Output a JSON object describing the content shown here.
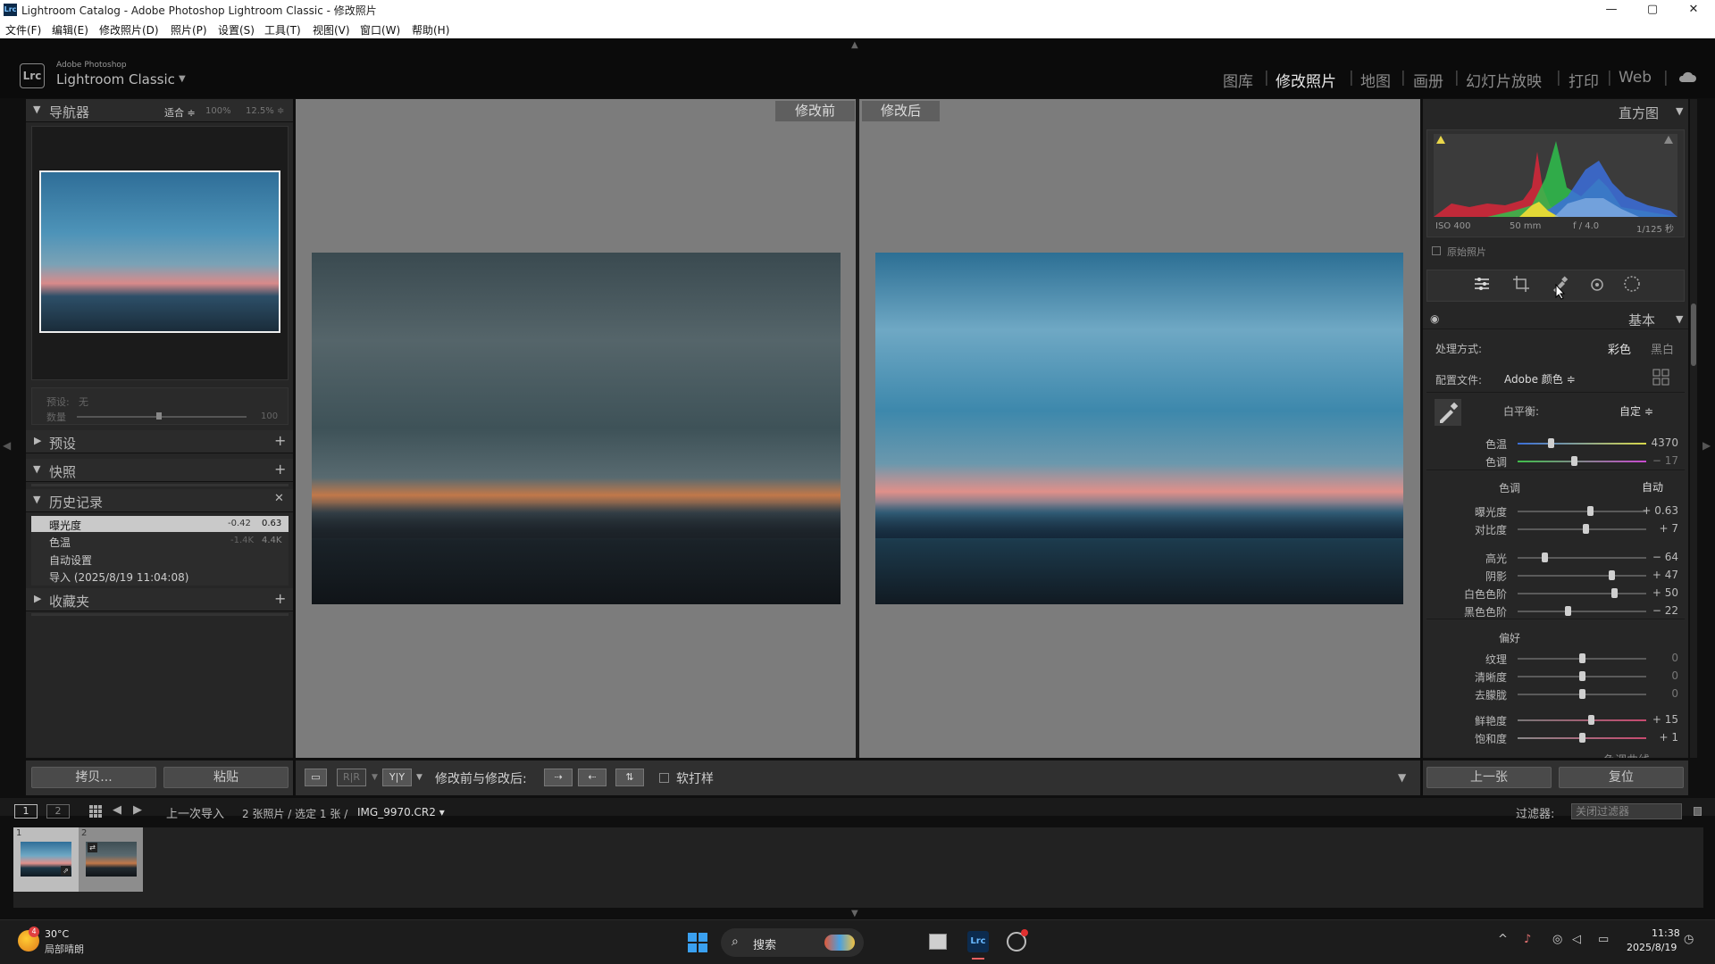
{
  "window": {
    "title": "Lightroom Catalog - Adobe Photoshop Lightroom Classic - 修改照片",
    "app_icon": "Lrc"
  },
  "menu": [
    "文件(F)",
    "编辑(E)",
    "修改照片(D)",
    "照片(P)",
    "设置(S)",
    "工具(T)",
    "视图(V)",
    "窗口(W)",
    "帮助(H)"
  ],
  "brand": {
    "top": "Adobe Photoshop",
    "name": "Lightroom Classic",
    "logo": "Lrc"
  },
  "modules": [
    "图库",
    "修改照片",
    "地图",
    "画册",
    "幻灯片放映",
    "打印",
    "Web"
  ],
  "active_module": "修改照片",
  "navigator": {
    "title": "导航器",
    "fit": "适合 ≑",
    "p100": "100%",
    "p125": "12.5% ≑"
  },
  "preset_box": {
    "preset_label": "预设:",
    "preset_value": "无",
    "amount_label": "数量",
    "amount_value": "100"
  },
  "left_sections": {
    "presets": "预设",
    "snapshots": "快照",
    "history": "历史记录",
    "collections": "收藏夹"
  },
  "history": [
    {
      "name": "曝光度",
      "a": "-0.42",
      "b": "0.63"
    },
    {
      "name": "色温",
      "a": "-1.4K",
      "b": "4.4K"
    },
    {
      "name": "自动设置",
      "a": "",
      "b": ""
    },
    {
      "name": "导入 (2025/8/19 11:04:08)",
      "a": "",
      "b": ""
    }
  ],
  "left_buttons": {
    "copy": "拷贝...",
    "paste": "粘贴"
  },
  "compare": {
    "before": "修改前",
    "after": "修改后"
  },
  "toolbar": {
    "compare_label": "修改前与修改后:",
    "softproof": "软打样",
    "yy": "Y|Y"
  },
  "histogram": {
    "title": "直方图",
    "iso": "ISO 400",
    "focal": "50 mm",
    "aperture": "f / 4.0",
    "shutter": "1/125 秒",
    "original": "原始照片"
  },
  "basic": {
    "title": "基本",
    "treatment_label": "处理方式:",
    "color": "彩色",
    "bw": "黑白",
    "profile_label": "配置文件:",
    "profile_value": "Adobe 颜色 ≑",
    "wb_label": "白平衡:",
    "wb_value": "自定 ≑",
    "tone_label": "色调",
    "auto": "自动",
    "presence_label": "偏好"
  },
  "sliders": [
    {
      "label": "色温",
      "value": "4370",
      "pos": 0.26
    },
    {
      "label": "色调",
      "value": "− 17",
      "pos": 0.44
    },
    {
      "label": "曝光度",
      "value": "+ 0.63",
      "pos": 0.56
    },
    {
      "label": "对比度",
      "value": "+ 7",
      "pos": 0.53
    },
    {
      "label": "高光",
      "value": "− 64",
      "pos": 0.21
    },
    {
      "label": "阴影",
      "value": "+ 47",
      "pos": 0.73
    },
    {
      "label": "白色色阶",
      "value": "+ 50",
      "pos": 0.75
    },
    {
      "label": "黑色色阶",
      "value": "− 22",
      "pos": 0.39
    },
    {
      "label": "纹理",
      "value": "0",
      "pos": 0.5
    },
    {
      "label": "清晰度",
      "value": "0",
      "pos": 0.5
    },
    {
      "label": "去朦胧",
      "value": "0",
      "pos": 0.5
    },
    {
      "label": "鲜艳度",
      "value": "+ 15",
      "pos": 0.57
    },
    {
      "label": "饱和度",
      "value": "+ 1",
      "pos": 0.5
    }
  ],
  "next_panel": "色调曲线",
  "right_buttons": {
    "prev": "上一张",
    "reset": "复位"
  },
  "filmstrip": {
    "page1": "1",
    "page2": "2",
    "source": "上一次导入",
    "count": "2 张照片 / 选定 1 张 /",
    "filename": "IMG_9970.CR2 ▾",
    "filter_label": "过滤器:",
    "filter_value": "关闭过滤器",
    "thumb1": "1",
    "thumb2": "2"
  },
  "taskbar": {
    "temp": "30°C",
    "weather": "局部晴朗",
    "search": "搜索",
    "time": "11:38",
    "date": "2025/8/19",
    "badge": "4"
  }
}
